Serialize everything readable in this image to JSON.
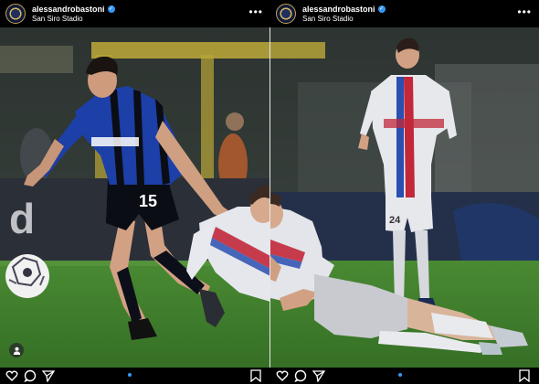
{
  "posts": [
    {
      "username": "alessandrobastoni",
      "location": "San Siro Stadio",
      "verified": true,
      "more_icon": "more-horizontal-icon",
      "footer_icons": [
        "heart-icon",
        "comment-icon",
        "share-icon",
        "bookmark-icon"
      ],
      "user_tag_icon": "person-icon"
    },
    {
      "username": "alessandrobastoni",
      "location": "San Siro Stadio",
      "verified": true,
      "more_icon": "more-horizontal-icon",
      "footer_icons": [
        "heart-icon",
        "comment-icon",
        "share-icon",
        "bookmark-icon"
      ]
    }
  ],
  "photo": {
    "left_player_shirt_number": "15",
    "right_player_shirt_number": "24",
    "colors": {
      "pitch": "#3f7f2c",
      "inter_blue": "#1c3fa8",
      "barca_stripe": "#c2283a",
      "ad_board": "#2b2f38"
    }
  }
}
